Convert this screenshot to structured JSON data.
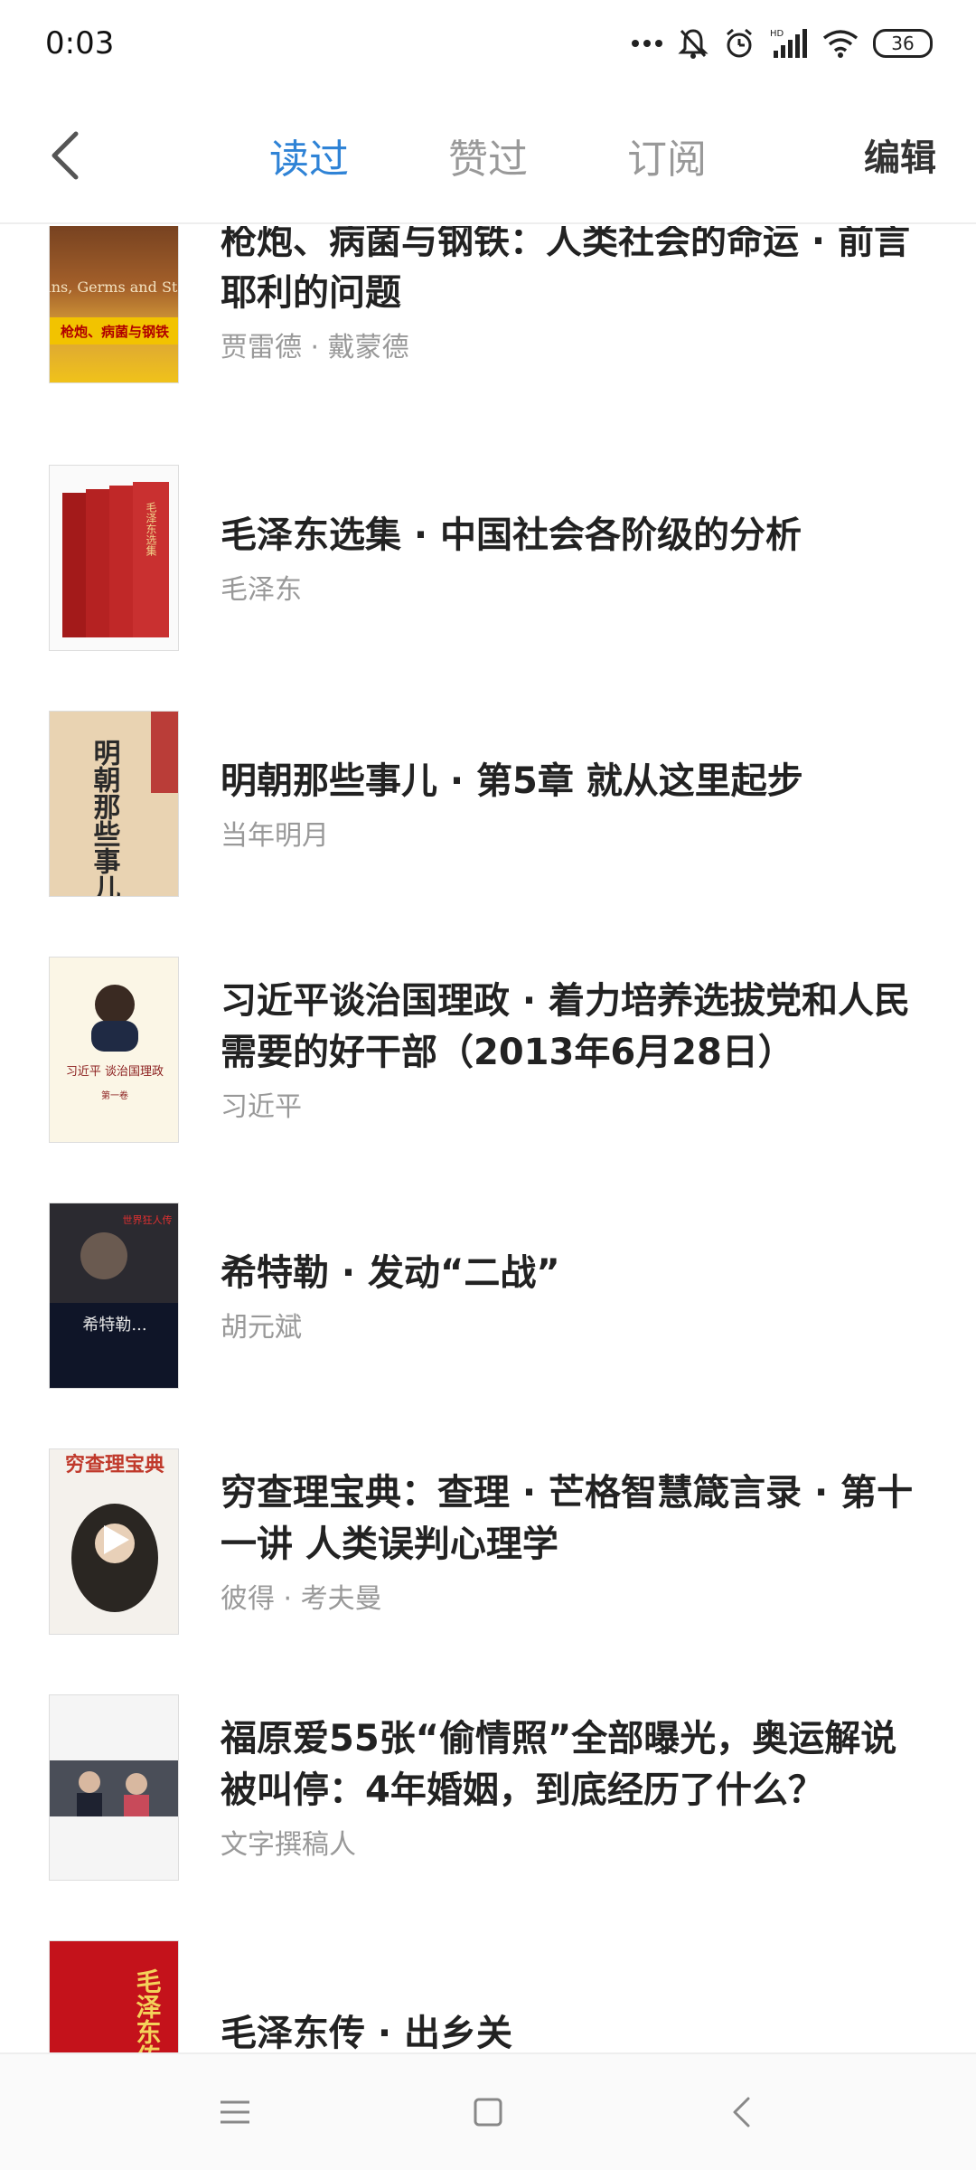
{
  "status_bar": {
    "time": "0:03",
    "battery": "36",
    "icons": [
      "more-dots-icon",
      "bell-off-icon",
      "alarm-icon",
      "hd-signal-icon",
      "wifi-icon",
      "battery-icon"
    ]
  },
  "nav": {
    "tabs": [
      {
        "label": "读过",
        "active": true
      },
      {
        "label": "赞过",
        "active": false
      },
      {
        "label": "订阅",
        "active": false
      }
    ],
    "edit_label": "编辑",
    "accent_color": "#2f83d6"
  },
  "items": [
    {
      "title": "枪炮、病菌与钢铁：人类社会的命运 · 前言 耶利的问题",
      "author": "贾雷德 · 戴蒙德",
      "cover_text": "Guns, Germs and Steel",
      "cover_subtext": "枪炮、病菌与钢铁"
    },
    {
      "title": "毛泽东选集 · 中国社会各阶级的分析",
      "author": "毛泽东",
      "cover_text": "毛泽东选集"
    },
    {
      "title": "明朝那些事儿 · 第5章 就从这里起步",
      "author": "当年明月",
      "cover_text": "明朝那些事儿"
    },
    {
      "title": "习近平谈治国理政 · 着力培养选拔党和人民需要的好干部（2013年6月28日）",
      "author": "习近平",
      "cover_text": "习近平 谈治国理政",
      "cover_subtext": "第一卷"
    },
    {
      "title": "希特勒 · 发动“二战”",
      "author": "胡元斌",
      "cover_text": "希特勒...",
      "cover_subtext": "世界狂人传"
    },
    {
      "title": "穷查理宝典：查理 · 芒格智慧箴言录 · 第十一讲 人类误判心理学",
      "author": "彼得 · 考夫曼",
      "cover_text": "穷查理宝典"
    },
    {
      "title": "福原爱55张“偷情照”全部曝光，奥运解说被叫停：4年婚姻，到底经历了什么？",
      "author": "文字撰稿人",
      "cover_text": ""
    },
    {
      "title": "毛泽东传 · 出乡关",
      "author": "",
      "cover_text": "毛泽东传"
    }
  ],
  "system_nav": {
    "icons": [
      "menu-icon",
      "home-square-icon",
      "back-chevron-icon"
    ]
  }
}
